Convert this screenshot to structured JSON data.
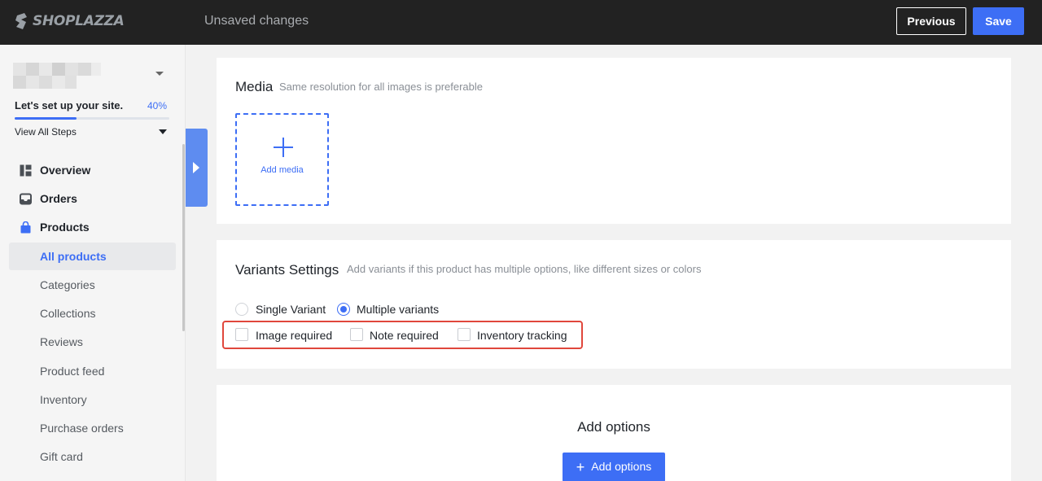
{
  "topbar": {
    "logo_text": "SHOPLAZZA",
    "status": "Unsaved changes",
    "previous_label": "Previous",
    "save_label": "Save"
  },
  "sidebar": {
    "setup_title": "Let's set up your site.",
    "setup_percent": "40%",
    "setup_progress": 0.4,
    "view_steps": "View All Steps",
    "items": [
      {
        "label": "Overview",
        "icon": "overview-icon"
      },
      {
        "label": "Orders",
        "icon": "inbox-icon"
      },
      {
        "label": "Products",
        "icon": "shopping-bag-icon"
      },
      {
        "label": "All products"
      },
      {
        "label": "Categories"
      },
      {
        "label": "Collections"
      },
      {
        "label": "Reviews"
      },
      {
        "label": "Product feed"
      },
      {
        "label": "Inventory"
      },
      {
        "label": "Purchase orders"
      },
      {
        "label": "Gift card"
      }
    ]
  },
  "media": {
    "title": "Media",
    "hint": "Same resolution for all images is preferable",
    "add_label": "Add media"
  },
  "variants": {
    "title": "Variants Settings",
    "hint": "Add variants if this product has multiple options, like different sizes or colors",
    "radio_single": "Single Variant",
    "radio_multiple": "Multiple variants",
    "selected": "Multiple variants",
    "check_image": "Image required",
    "check_note": "Note required",
    "check_inventory": "Inventory tracking"
  },
  "options": {
    "title": "Add options",
    "button_label": "Add options"
  },
  "colors": {
    "accent": "#3d6ef5",
    "topbar": "#222222",
    "highlight": "#e0473c"
  }
}
